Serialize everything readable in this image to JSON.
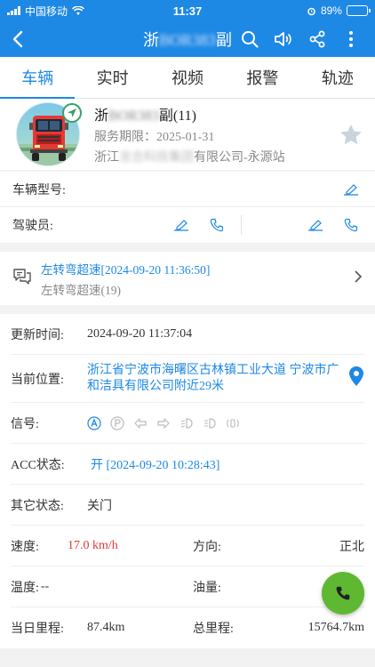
{
  "status_bar": {
    "carrier": "中国移动",
    "time": "11:37",
    "battery": "89%",
    "battery_level": 0.89
  },
  "nav": {
    "title_prefix": "浙",
    "title_blurred": "BOR383",
    "title_suffix": "副",
    "icons": [
      "back-icon",
      "search-icon",
      "volume-icon",
      "share-icon",
      "more-icon"
    ]
  },
  "tabs": [
    {
      "label": "车辆",
      "active": true
    },
    {
      "label": "实时",
      "active": false
    },
    {
      "label": "视频",
      "active": false
    },
    {
      "label": "报警",
      "active": false
    },
    {
      "label": "轨迹",
      "active": false
    }
  ],
  "vehicle": {
    "name_prefix": "浙",
    "name_blurred": "BOR383",
    "name_suffix": "副(11)",
    "service_label": "服务期限：",
    "service_date": "2025-01-31",
    "company_prefix": "浙江",
    "company_blurred": "龙合科技集团",
    "company_suffix": "有限公司-永源站"
  },
  "info": {
    "model_label": "车辆型号:",
    "driver_label": "驾驶员:"
  },
  "alarm": {
    "title": "左转弯超速[2024-09-20 11:36:50]",
    "subtitle": "左转弯超速(19)"
  },
  "details": {
    "update_label": "更新时间:",
    "update_value": "2024-09-20 11:37:04",
    "location_label": "当前位置:",
    "location_value": "浙江省宁波市海曙区古林镇工业大道 宁波市广和洁具有限公司附近29米",
    "signal_label": "信号:",
    "acc_label": "ACC状态:",
    "acc_value": "开 [2024-09-20 10:28:43]",
    "other_label": "其它状态:",
    "other_value": "关门",
    "speed_label": "速度:",
    "speed_value": "17.0 km/h",
    "direction_label": "方向:",
    "direction_value": "正北",
    "temp_label": "温度:",
    "temp_value": "--",
    "fuel_label": "油量:",
    "fuel_value": "",
    "day_mileage_label": "当日里程:",
    "day_mileage_value": "87.4km",
    "total_mileage_label": "总里程:",
    "total_mileage_value": "15764.7km"
  },
  "colors": {
    "primary": "#1e88e5",
    "speed": "#e53935",
    "fab": "#5fb832",
    "location_badge": "#38a169"
  }
}
